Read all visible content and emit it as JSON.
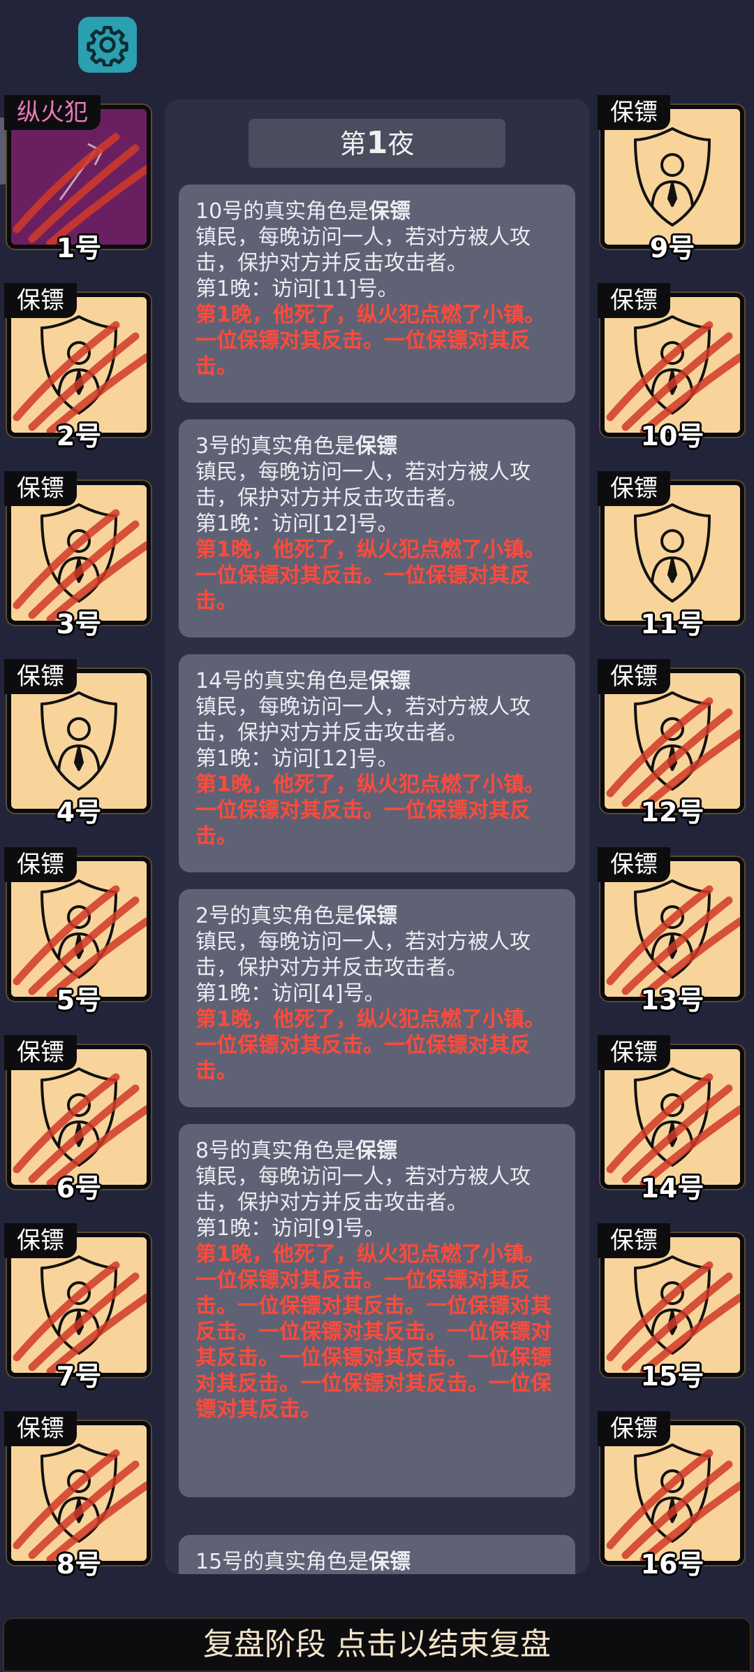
{
  "settings_icon": "gear-icon",
  "night_label": {
    "prefix": "第",
    "number": "1",
    "suffix": "夜"
  },
  "cards_left": [
    {
      "role": "纵火犯",
      "number": "1号",
      "type": "arsonist",
      "dead": true
    },
    {
      "role": "保镖",
      "number": "2号",
      "type": "bodyguard",
      "dead": true
    },
    {
      "role": "保镖",
      "number": "3号",
      "type": "bodyguard",
      "dead": true
    },
    {
      "role": "保镖",
      "number": "4号",
      "type": "bodyguard",
      "dead": false
    },
    {
      "role": "保镖",
      "number": "5号",
      "type": "bodyguard",
      "dead": true
    },
    {
      "role": "保镖",
      "number": "6号",
      "type": "bodyguard",
      "dead": true
    },
    {
      "role": "保镖",
      "number": "7号",
      "type": "bodyguard",
      "dead": true
    },
    {
      "role": "保镖",
      "number": "8号",
      "type": "bodyguard",
      "dead": true
    }
  ],
  "cards_right": [
    {
      "role": "保镖",
      "number": "9号",
      "type": "bodyguard",
      "dead": false
    },
    {
      "role": "保镖",
      "number": "10号",
      "type": "bodyguard",
      "dead": true
    },
    {
      "role": "保镖",
      "number": "11号",
      "type": "bodyguard",
      "dead": false
    },
    {
      "role": "保镖",
      "number": "12号",
      "type": "bodyguard",
      "dead": true
    },
    {
      "role": "保镖",
      "number": "13号",
      "type": "bodyguard",
      "dead": true
    },
    {
      "role": "保镖",
      "number": "14号",
      "type": "bodyguard",
      "dead": true
    },
    {
      "role": "保镖",
      "number": "15号",
      "type": "bodyguard",
      "dead": true
    },
    {
      "role": "保镖",
      "number": "16号",
      "type": "bodyguard",
      "dead": true
    }
  ],
  "logs": [
    {
      "title_prefix": "10号的真实角色是",
      "title_role": "保镖",
      "description": "镇民，每晚访问一人，若对方被人攻击，保护对方并反击攻击者。",
      "visit": "第1晚：访问[11]号。",
      "event": "第1晚，他死了，纵火犯点燃了小镇。一位保镖对其反击。一位保镖对其反击。"
    },
    {
      "title_prefix": "3号的真实角色是",
      "title_role": "保镖",
      "description": "镇民，每晚访问一人，若对方被人攻击，保护对方并反击攻击者。",
      "visit": "第1晚：访问[12]号。",
      "event": "第1晚，他死了，纵火犯点燃了小镇。一位保镖对其反击。一位保镖对其反击。"
    },
    {
      "title_prefix": "14号的真实角色是",
      "title_role": "保镖",
      "description": "镇民，每晚访问一人，若对方被人攻击，保护对方并反击攻击者。",
      "visit": "第1晚：访问[12]号。",
      "event": "第1晚，他死了，纵火犯点燃了小镇。一位保镖对其反击。一位保镖对其反击。"
    },
    {
      "title_prefix": "2号的真实角色是",
      "title_role": "保镖",
      "description": "镇民，每晚访问一人，若对方被人攻击，保护对方并反击攻击者。",
      "visit": "第1晚：访问[4]号。",
      "event": "第1晚，他死了，纵火犯点燃了小镇。一位保镖对其反击。一位保镖对其反击。"
    },
    {
      "title_prefix": "8号的真实角色是",
      "title_role": "保镖",
      "description": "镇民，每晚访问一人，若对方被人攻击，保护对方并反击攻击者。",
      "visit": "第1晚：访问[9]号。",
      "event": "第1晚，他死了，纵火犯点燃了小镇。一位保镖对其反击。一位保镖对其反击。一位保镖对其反击。一位保镖对其反击。一位保镖对其反击。一位保镖对其反击。一位保镖对其反击。一位保镖对其反击。一位保镖对其反击。一位保镖对其反击。"
    },
    {
      "title_prefix": "15号的真实角色是",
      "title_role": "保镖",
      "description": "",
      "visit": "",
      "event": ""
    }
  ],
  "bottom_bar": "复盘阶段 点击以结束复盘",
  "colors": {
    "background": "#22243a",
    "panel": "#2d3045",
    "log_card": "#5f6274",
    "event_red": "#ff4a3a",
    "card_bg": "#f8d49a",
    "gear_bg": "#2aa0b0"
  }
}
